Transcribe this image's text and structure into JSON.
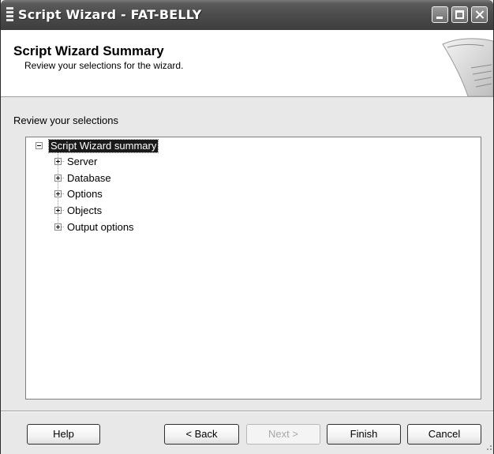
{
  "window": {
    "title": "Script Wizard - FAT-BELLY"
  },
  "header": {
    "title": "Script Wizard Summary",
    "subtitle": "Review your selections for the wizard."
  },
  "content": {
    "label": "Review your selections",
    "tree": {
      "root": "Script Wizard summary",
      "children": [
        "Server",
        "Database",
        "Options",
        "Objects",
        "Output options"
      ]
    }
  },
  "buttons": {
    "help": "Help",
    "back": "< Back",
    "next": "Next >",
    "finish": "Finish",
    "cancel": "Cancel"
  },
  "colors": {
    "titlebar": "#4b4b4b",
    "selection": "#1a1a1a"
  }
}
